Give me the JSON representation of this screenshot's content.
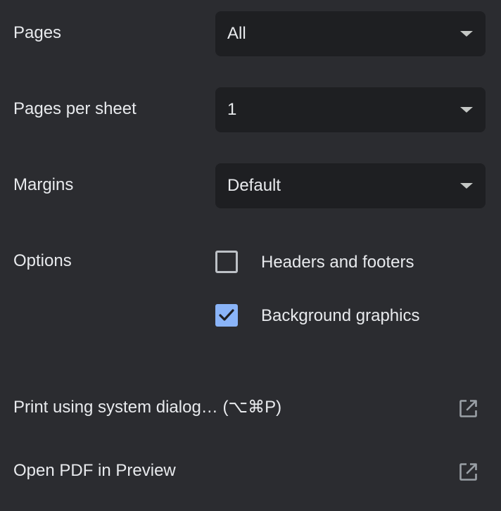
{
  "pages": {
    "label": "Pages",
    "value": "All"
  },
  "pages_per_sheet": {
    "label": "Pages per sheet",
    "value": "1"
  },
  "margins": {
    "label": "Margins",
    "value": "Default"
  },
  "options": {
    "label": "Options",
    "headers_footers": {
      "label": "Headers and footers",
      "checked": false
    },
    "background_graphics": {
      "label": "Background graphics",
      "checked": true
    }
  },
  "links": {
    "system_dialog": {
      "label": "Print using system dialog… (⌥⌘P)",
      "icon": "open-in-new-icon"
    },
    "open_pdf": {
      "label": "Open PDF in Preview",
      "icon": "open-in-new-icon"
    }
  },
  "colors": {
    "background": "#2b2c30",
    "select_background": "#1e1f22",
    "text": "#e8eaed",
    "accent": "#8ab4f8"
  }
}
